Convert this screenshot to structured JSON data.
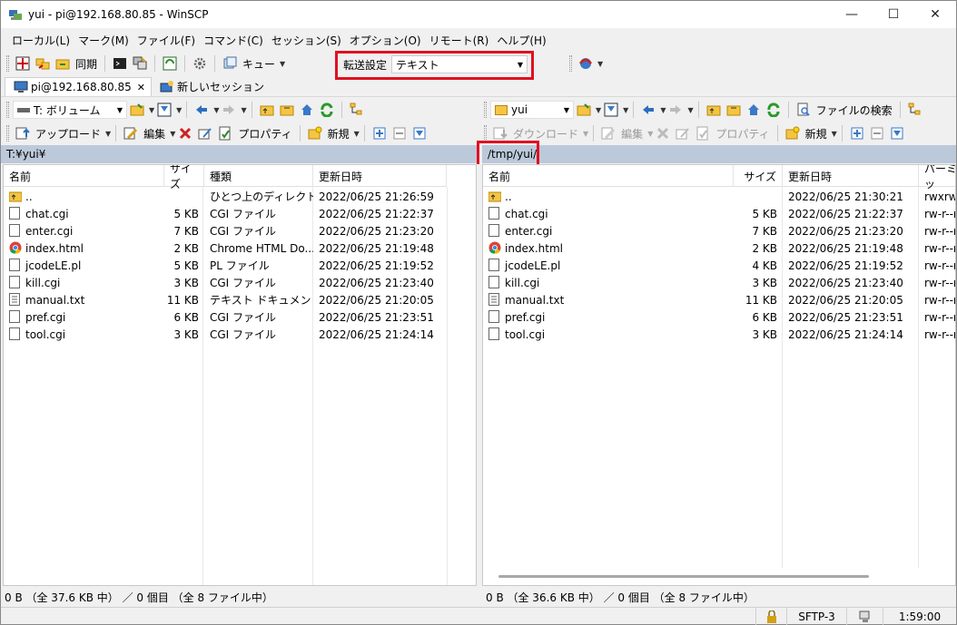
{
  "window": {
    "title": "yui - pi@192.168.80.85 - WinSCP",
    "minimize": "—",
    "maximize": "☐",
    "close": "✕"
  },
  "menu": [
    "ローカル(L)",
    "マーク(M)",
    "ファイル(F)",
    "コマンド(C)",
    "セッション(S)",
    "オプション(O)",
    "リモート(R)",
    "ヘルプ(H)"
  ],
  "toolbar": {
    "sync_label": "同期",
    "queue_label": "キュー",
    "transfer_label": "転送設定",
    "transfer_value": "テキスト"
  },
  "tabs": {
    "session_label": "pi@192.168.80.85",
    "close_icon": "✕",
    "new_session_label": "新しいセッション"
  },
  "local": {
    "drive": "T: ボリューム",
    "upload_label": "アップロード",
    "edit_label": "編集",
    "properties_label": "プロパティ",
    "new_label": "新規",
    "path": "T:¥yui¥",
    "columns": [
      "名前",
      "サイズ",
      "種類",
      "更新日時"
    ],
    "files": [
      {
        "name": "..",
        "size": "",
        "type": "ひとつ上のディレクトリ",
        "date": "2022/06/25  21:26:59",
        "icon": "folder-up-icon"
      },
      {
        "name": "chat.cgi",
        "size": "5 KB",
        "type": "CGI ファイル",
        "date": "2022/06/25  21:22:37",
        "icon": "file-icon"
      },
      {
        "name": "enter.cgi",
        "size": "7 KB",
        "type": "CGI ファイル",
        "date": "2022/06/25  21:23:20",
        "icon": "file-icon"
      },
      {
        "name": "index.html",
        "size": "2 KB",
        "type": "Chrome HTML Do...",
        "date": "2022/06/25  21:19:48",
        "icon": "chrome-icon"
      },
      {
        "name": "jcodeLE.pl",
        "size": "5 KB",
        "type": "PL ファイル",
        "date": "2022/06/25  21:19:52",
        "icon": "file-icon"
      },
      {
        "name": "kill.cgi",
        "size": "3 KB",
        "type": "CGI ファイル",
        "date": "2022/06/25  21:23:40",
        "icon": "file-icon"
      },
      {
        "name": "manual.txt",
        "size": "11 KB",
        "type": "テキスト ドキュメント",
        "date": "2022/06/25  21:20:05",
        "icon": "text-file-icon"
      },
      {
        "name": "pref.cgi",
        "size": "6 KB",
        "type": "CGI ファイル",
        "date": "2022/06/25  21:23:51",
        "icon": "file-icon"
      },
      {
        "name": "tool.cgi",
        "size": "3 KB",
        "type": "CGI ファイル",
        "date": "2022/06/25  21:24:14",
        "icon": "file-icon"
      }
    ],
    "status": "0 B （全 37.6 KB 中） ／ 0 個目 （全 8 ファイル中）"
  },
  "remote": {
    "folder": "yui",
    "download_label": "ダウンロード",
    "edit_label": "編集",
    "properties_label": "プロパティ",
    "new_label": "新規",
    "find_label": "ファイルの検索",
    "path": "/tmp/yui/",
    "columns": [
      "名前",
      "サイズ",
      "更新日時",
      "パーミッ"
    ],
    "files": [
      {
        "name": "..",
        "size": "",
        "date": "2022/06/25  21:30:21",
        "perm": "rwxrwx",
        "icon": "folder-up-icon"
      },
      {
        "name": "chat.cgi",
        "size": "5 KB",
        "date": "2022/06/25  21:22:37",
        "perm": "rw-r--r",
        "icon": "file-icon"
      },
      {
        "name": "enter.cgi",
        "size": "7 KB",
        "date": "2022/06/25  21:23:20",
        "perm": "rw-r--r",
        "icon": "file-icon"
      },
      {
        "name": "index.html",
        "size": "2 KB",
        "date": "2022/06/25  21:19:48",
        "perm": "rw-r--r",
        "icon": "chrome-icon"
      },
      {
        "name": "jcodeLE.pl",
        "size": "4 KB",
        "date": "2022/06/25  21:19:52",
        "perm": "rw-r--r",
        "icon": "file-icon"
      },
      {
        "name": "kill.cgi",
        "size": "3 KB",
        "date": "2022/06/25  21:23:40",
        "perm": "rw-r--r",
        "icon": "file-icon"
      },
      {
        "name": "manual.txt",
        "size": "11 KB",
        "date": "2022/06/25  21:20:05",
        "perm": "rw-r--r",
        "icon": "text-file-icon"
      },
      {
        "name": "pref.cgi",
        "size": "6 KB",
        "date": "2022/06/25  21:23:51",
        "perm": "rw-r--r",
        "icon": "file-icon"
      },
      {
        "name": "tool.cgi",
        "size": "3 KB",
        "date": "2022/06/25  21:24:14",
        "perm": "rw-r--r",
        "icon": "file-icon"
      }
    ],
    "status": "0 B （全 36.6 KB 中） ／ 0 個目 （全 8 ファイル中）"
  },
  "bottom": {
    "protocol": "SFTP-3",
    "time": "1:59:00"
  },
  "colors": {
    "highlight_box": "#e01020",
    "path_bar": "#bcc9da"
  }
}
